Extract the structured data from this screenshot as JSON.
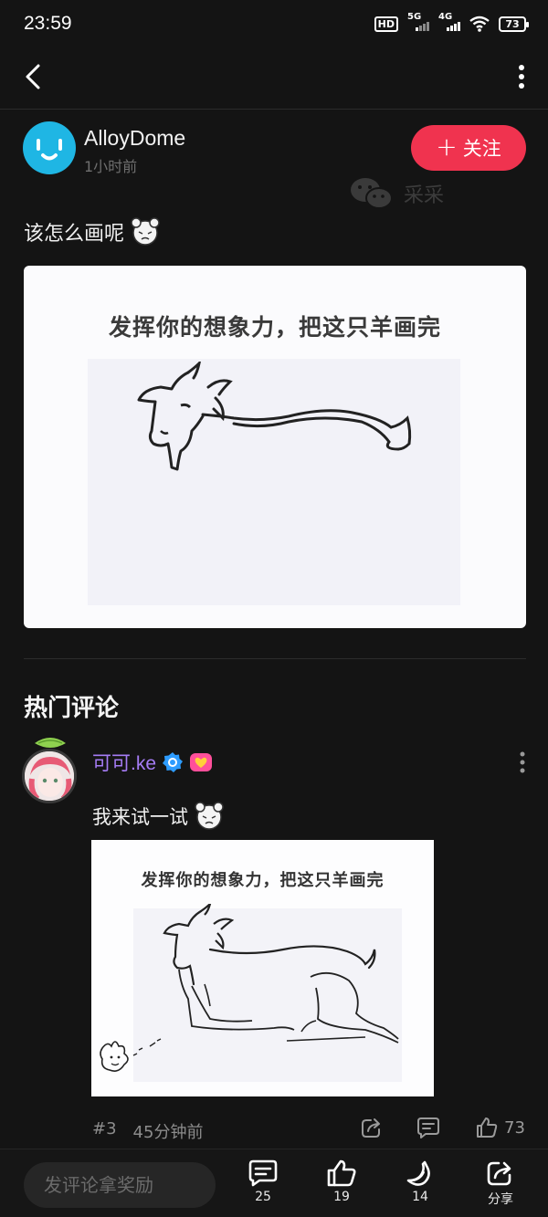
{
  "status_bar": {
    "time": "23:59",
    "hd_label": "HD",
    "net1_label": "5G",
    "net2_label": "4G",
    "battery": "73"
  },
  "post": {
    "author_name": "AlloyDome",
    "time": "1小时前",
    "follow_label": "关注",
    "watermark_text": "采采",
    "text": "该怎么画呢",
    "image_caption": "发挥你的想象力，把这只羊画完"
  },
  "hot_comments_title": "热门评论",
  "comment": {
    "user_name": "可可.ke",
    "text": "我来试一试",
    "image_caption": "发挥你的想象力，把这只羊画完",
    "floor": "#3",
    "time": "45分钟前",
    "like_count": "73"
  },
  "bottom_bar": {
    "input_placeholder": "发评论拿奖励",
    "comments_count": "25",
    "likes_count": "19",
    "bananas_count": "14",
    "share_label": "分享"
  },
  "colors": {
    "background": "#141414",
    "follow_button": "#f0334f",
    "username_accent": "#a57cf5",
    "author_avatar": "#1fb6e4"
  },
  "icons": [
    "back-icon",
    "more-icon",
    "plus-icon",
    "wechat-icon",
    "emoji-sticker-icon",
    "verified-badge-icon",
    "heart-badge-icon",
    "share-icon",
    "comment-icon",
    "like-icon",
    "banana-icon"
  ]
}
